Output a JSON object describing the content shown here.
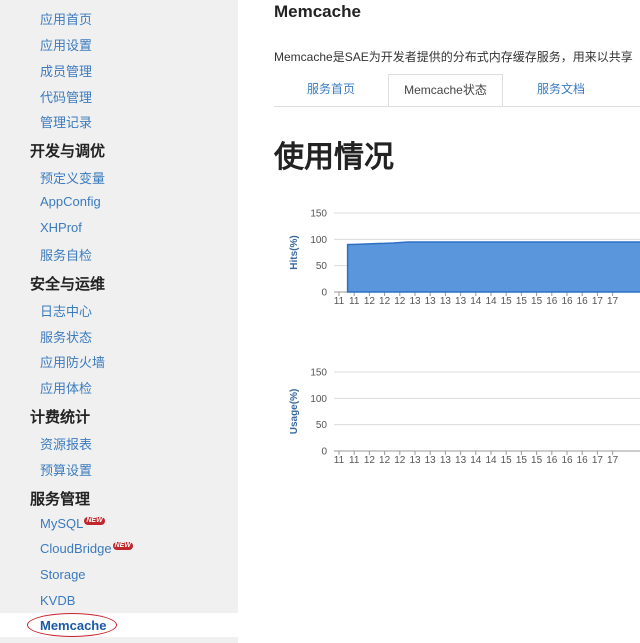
{
  "sidebar": {
    "items_top": [
      "应用首页",
      "应用设置",
      "成员管理",
      "代码管理",
      "管理记录"
    ],
    "groups": [
      {
        "heading": "开发与调优",
        "items": [
          "预定义变量",
          "AppConfig",
          "XHProf",
          "服务自检"
        ]
      },
      {
        "heading": "安全与运维",
        "items": [
          "日志中心",
          "服务状态",
          "应用防火墙",
          "应用体检"
        ]
      },
      {
        "heading": "计费统计",
        "items": [
          "资源报表",
          "预算设置"
        ]
      },
      {
        "heading": "服务管理",
        "items": [
          "MySQL",
          "CloudBridge",
          "Storage",
          "KVDB"
        ]
      }
    ],
    "new_badge": "NEW",
    "active_item": "Memcache"
  },
  "main": {
    "title": "Memcache",
    "description": "Memcache是SAE为开发者提供的分布式内存缓存服务，用来以共享",
    "tabs": [
      "服务首页",
      "Memcache状态",
      "服务文档"
    ],
    "active_tab": 1,
    "section_title": "使用情况"
  },
  "colors": {
    "link": "#3b7bbf",
    "area_fill": "#5a96dc",
    "area_stroke": "#2e6fc4",
    "highlight_circle": "#c8232c"
  },
  "chart_data": [
    {
      "type": "area",
      "ylabel": "Hits(%)",
      "ylim": [
        0,
        150
      ],
      "yticks": [
        0,
        50,
        100,
        150
      ],
      "xticks": [
        "11",
        "11",
        "12",
        "12",
        "12",
        "13",
        "13",
        "13",
        "13",
        "14",
        "14",
        "15",
        "15",
        "15",
        "16",
        "16",
        "16",
        "17",
        "17"
      ],
      "series": [
        {
          "values": [
            null,
            90,
            91,
            92,
            93,
            95,
            95,
            95,
            95,
            95,
            95,
            95,
            95,
            95,
            95,
            95,
            95,
            95,
            95
          ]
        }
      ],
      "grid": true
    },
    {
      "type": "area",
      "ylabel": "Usage(%)",
      "ylim": [
        0,
        150
      ],
      "yticks": [
        0,
        50,
        100,
        150
      ],
      "xticks": [
        "11",
        "11",
        "12",
        "12",
        "12",
        "13",
        "13",
        "13",
        "13",
        "14",
        "14",
        "15",
        "15",
        "15",
        "16",
        "16",
        "16",
        "17",
        "17"
      ],
      "series": [
        {
          "values": []
        }
      ],
      "grid": true
    }
  ]
}
